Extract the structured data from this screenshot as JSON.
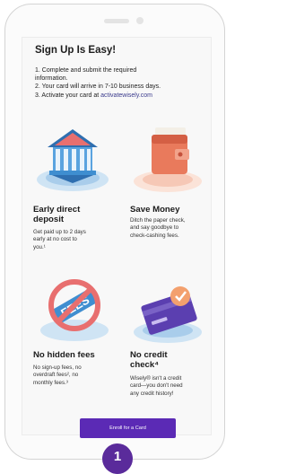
{
  "signup": {
    "title": "Sign Up Is Easy!",
    "step1_line1": "1. Complete and submit the required",
    "step1_line2": "information.",
    "step2": "2. Your card will arrive in 7-10 business days.",
    "step3_prefix": "3. Activate your card at ",
    "step3_link": "activatewisely.com"
  },
  "features": [
    {
      "title_line1": "Early direct",
      "title_line2": "deposit",
      "desc_lines": [
        "Get paid up to 2 days",
        "early at no cost to",
        "you.¹"
      ],
      "icon": "bank-icon"
    },
    {
      "title_line1": "Save Money",
      "desc_lines": [
        "Ditch the paper check,",
        "and say goodbye to",
        "check-cashing fees."
      ],
      "icon": "wallet-icon"
    },
    {
      "title_line1": "No hidden fees",
      "desc_lines": [
        "No sign-up fees, no",
        "overdraft fees², no",
        "monthly fees.³"
      ],
      "icon": "no-fees-icon",
      "fees_text": "FEES"
    },
    {
      "title_line1": "No credit",
      "title_line2": "check⁴",
      "desc_lines": [
        "Wisely® isn't a credit",
        "card—you don't need",
        "any credit history!"
      ],
      "icon": "credit-card-check-icon"
    }
  ],
  "enroll_button": "Enroll for a Card",
  "step_badge": "1",
  "colors": {
    "accent": "#5b2ab5",
    "badge": "#5a2b9b",
    "illustration_blue": "#3f8ed0",
    "illustration_pink": "#e86f6f"
  }
}
